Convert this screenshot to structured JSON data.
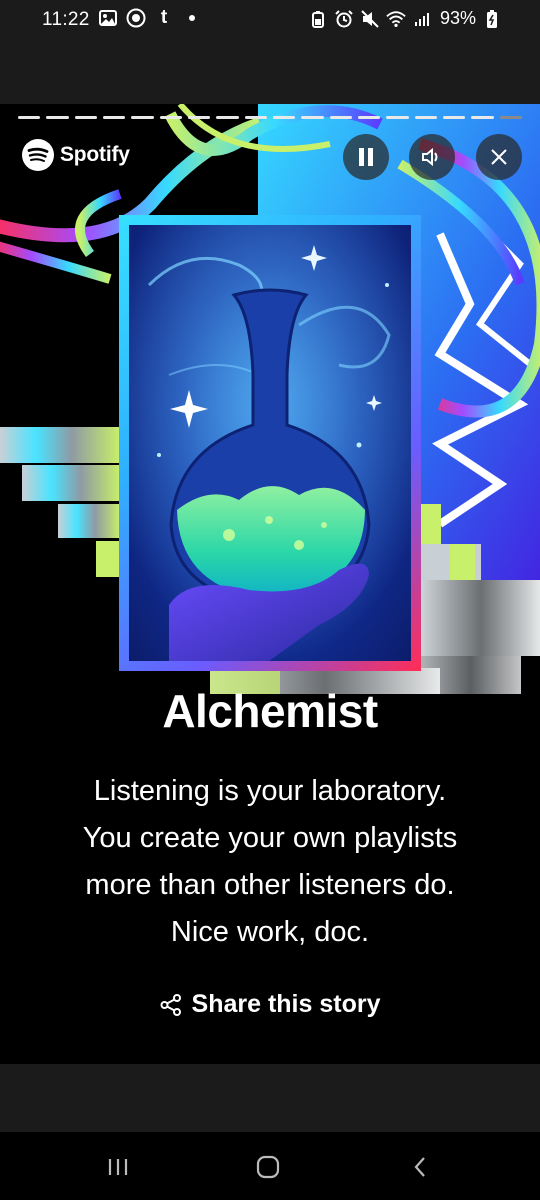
{
  "status_bar": {
    "time": "11:22",
    "battery_percent": "93%",
    "left_icons": [
      "gallery-icon",
      "instagram-icon",
      "tumblr-icon",
      "dot-icon"
    ],
    "right_icons": [
      "alarm-battery-icon",
      "alarm-icon",
      "mute-icon",
      "wifi-icon",
      "signal-icon",
      "battery-icon"
    ]
  },
  "story": {
    "progress_segments_total": 18,
    "progress_segments_complete": 17,
    "brand": "Spotify",
    "title": "Alchemist",
    "description_lines": [
      "Listening is your laboratory.",
      "You create your own playlists",
      "more than other listeners do.",
      "Nice work, doc."
    ],
    "share_label": "Share this story",
    "controls": [
      "pause-icon",
      "volume-icon",
      "close-icon"
    ],
    "colors": {
      "accent_cyan": "#37e0ff",
      "accent_lime": "#c8f06a",
      "accent_red": "#ff2d55",
      "accent_purple": "#6a5cff"
    }
  },
  "nav": {
    "buttons": [
      "recents-icon",
      "home-icon",
      "back-icon"
    ]
  }
}
